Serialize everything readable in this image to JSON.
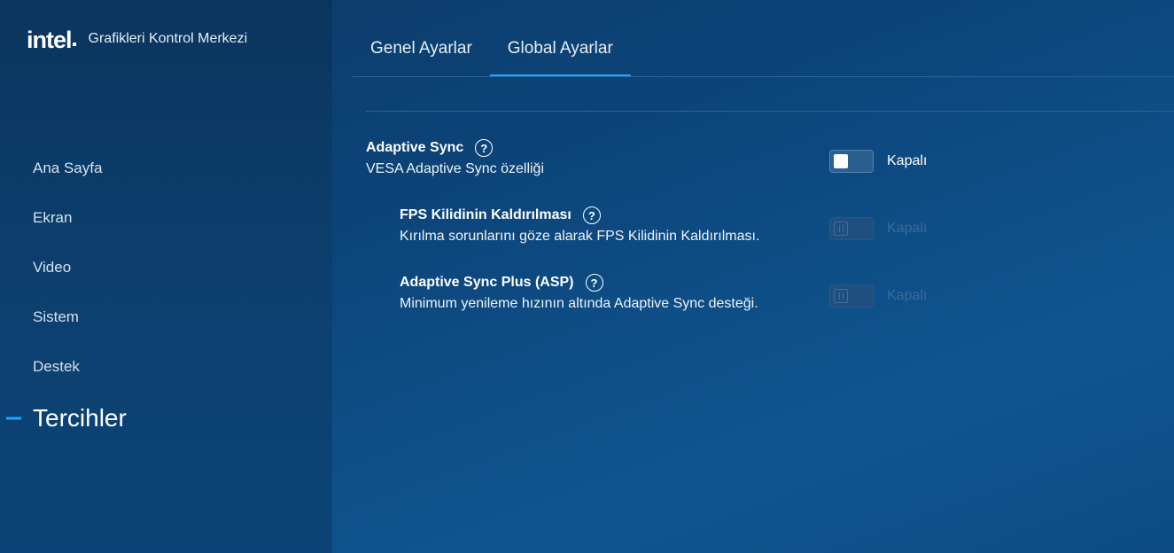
{
  "app": {
    "logo_text": "intel",
    "title": "Grafikleri Kontrol Merkezi"
  },
  "sidebar": {
    "items": [
      {
        "label": "Ana Sayfa"
      },
      {
        "label": "Ekran"
      },
      {
        "label": "Video"
      },
      {
        "label": "Sistem"
      },
      {
        "label": "Destek"
      },
      {
        "label": "Tercihler",
        "active": true
      }
    ]
  },
  "tabs": [
    {
      "label": "Genel Ayarlar"
    },
    {
      "label": "Global Ayarlar",
      "active": true
    }
  ],
  "settings": {
    "adaptive_sync": {
      "title": "Adaptive Sync",
      "description": "VESA Adaptive Sync özelliği",
      "state": "Kapalı",
      "enabled": true
    },
    "fps_unlock": {
      "title": "FPS Kilidinin Kaldırılması",
      "description": "Kırılma sorunlarını göze alarak FPS Kilidinin Kaldırılması.",
      "state": "Kapalı",
      "enabled": false
    },
    "asp": {
      "title": "Adaptive Sync Plus (ASP)",
      "description": "Minimum yenileme hızının altında Adaptive Sync desteği.",
      "state": "Kapalı",
      "enabled": false
    }
  },
  "help_glyph": "?",
  "colors": {
    "accent": "#1ea7ff",
    "background": "#0c4478",
    "sidebar": "#0a355e"
  }
}
